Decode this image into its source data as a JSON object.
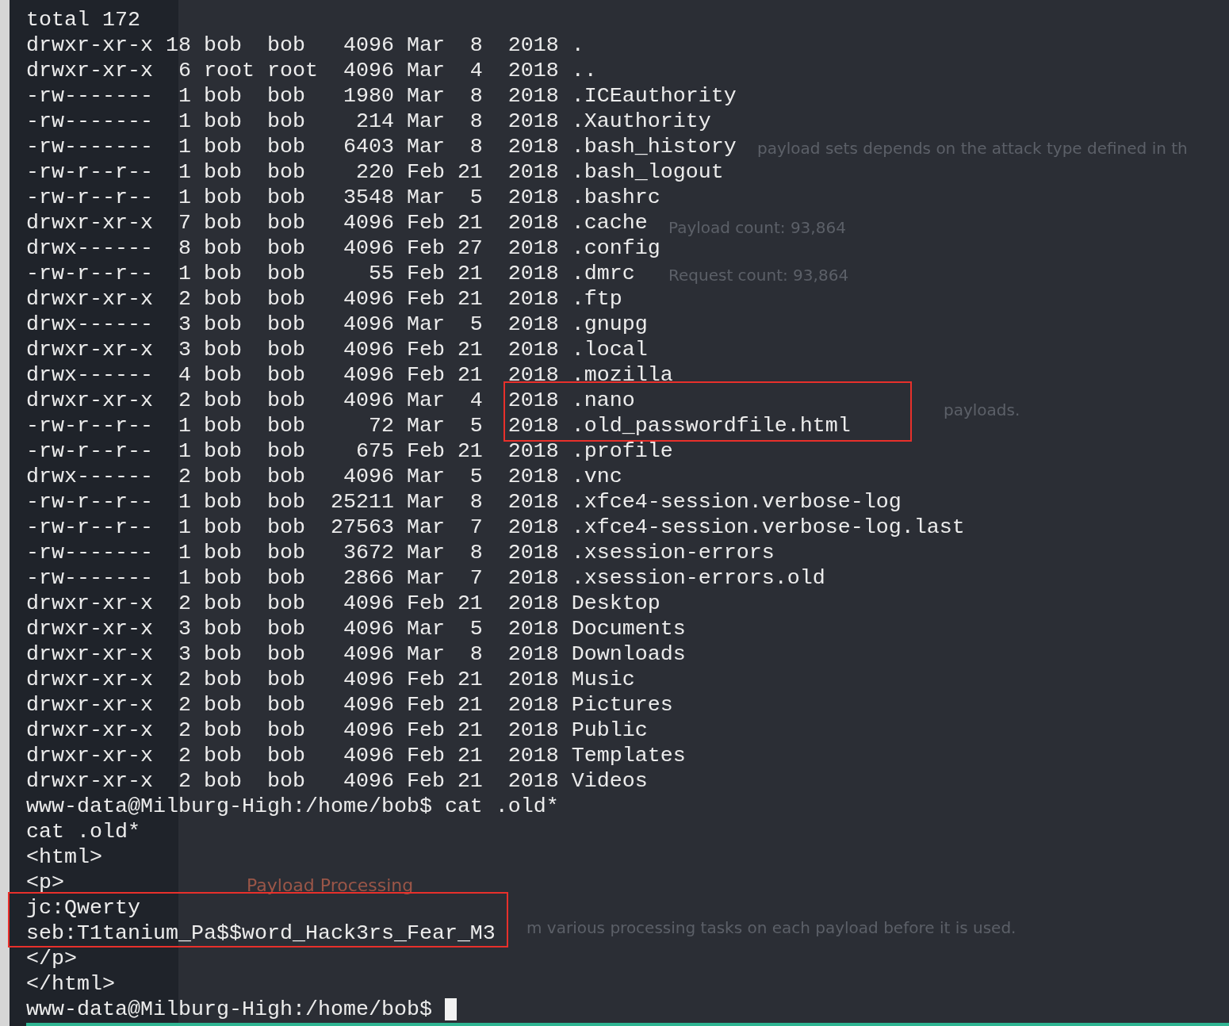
{
  "background_window": {
    "texts": [
      {
        "kind": "sentence",
        "text": "payload sets depends on the attack type defined in th"
      },
      {
        "kind": "stat",
        "text": "Payload count:  93,864"
      },
      {
        "kind": "stat",
        "text": "Request count:  93,864"
      },
      {
        "kind": "sentence",
        "text": "payloads."
      },
      {
        "kind": "heading",
        "text": "Payload Processing"
      },
      {
        "kind": "sentence",
        "text": "m various processing tasks on each payload before it is used."
      }
    ]
  },
  "terminal": {
    "blocks": [
      {
        "kind": "plain",
        "lines": [
          "total 172",
          "drwxr-xr-x 18 bob  bob   4096 Mar  8  2018 .",
          "drwxr-xr-x  6 root root  4096 Mar  4  2018 ..",
          "-rw-------  1 bob  bob   1980 Mar  8  2018 .ICEauthority",
          "-rw-------  1 bob  bob    214 Mar  8  2018 .Xauthority",
          "-rw-------  1 bob  bob   6403 Mar  8  2018 .bash_history",
          "-rw-r--r--  1 bob  bob    220 Feb 21  2018 .bash_logout",
          "-rw-r--r--  1 bob  bob   3548 Mar  5  2018 .bashrc",
          "drwxr-xr-x  7 bob  bob   4096 Feb 21  2018 .cache",
          "drwx------  8 bob  bob   4096 Feb 27  2018 .config",
          "-rw-r--r--  1 bob  bob     55 Feb 21  2018 .dmrc",
          "drwxr-xr-x  2 bob  bob   4096 Feb 21  2018 .ftp",
          "drwx------  3 bob  bob   4096 Mar  5  2018 .gnupg",
          "drwxr-xr-x  3 bob  bob   4096 Feb 21  2018 .local",
          "drwx------  4 bob  bob   4096 Feb 21  2018 .mozilla"
        ]
      },
      {
        "kind": "boxed",
        "lines": [
          {
            "before": "drwxr-xr-x  2 bob  bob   4096 Mar  4  ",
            "boxed": "2018 .nano"
          },
          {
            "before": "-rw-r--r--  1 bob  bob     72 Mar  5  ",
            "boxed": "2018 .old_passwordfile.html"
          }
        ]
      },
      {
        "kind": "plain",
        "lines": [
          "-rw-r--r--  1 bob  bob    675 Feb 21  2018 .profile",
          "drwx------  2 bob  bob   4096 Mar  5  2018 .vnc",
          "-rw-r--r--  1 bob  bob  25211 Mar  8  2018 .xfce4-session.verbose-log",
          "-rw-r--r--  1 bob  bob  27563 Mar  7  2018 .xfce4-session.verbose-log.last",
          "-rw-------  1 bob  bob   3672 Mar  8  2018 .xsession-errors",
          "-rw-------  1 bob  bob   2866 Mar  7  2018 .xsession-errors.old",
          "drwxr-xr-x  2 bob  bob   4096 Feb 21  2018 Desktop",
          "drwxr-xr-x  3 bob  bob   4096 Mar  5  2018 Documents",
          "drwxr-xr-x  3 bob  bob   4096 Mar  8  2018 Downloads",
          "drwxr-xr-x  2 bob  bob   4096 Feb 21  2018 Music",
          "drwxr-xr-x  2 bob  bob   4096 Feb 21  2018 Pictures",
          "drwxr-xr-x  2 bob  bob   4096 Feb 21  2018 Public",
          "drwxr-xr-x  2 bob  bob   4096 Feb 21  2018 Templates",
          "drwxr-xr-x  2 bob  bob   4096 Feb 21  2018 Videos",
          "www-data@Milburg-High:/home/bob$ cat .old*",
          "cat .old*",
          "<html>",
          "<p>"
        ]
      },
      {
        "kind": "boxed",
        "lines": [
          {
            "boxed": "jc:Qwerty"
          },
          {
            "boxed": "seb:T1tanium_Pa$$word_Hack3rs_Fear_M3"
          }
        ]
      },
      {
        "kind": "plain",
        "lines": [
          "</p>",
          "</html>"
        ]
      }
    ],
    "prompt": {
      "text": "www-data@Milburg-High:/home/bob$ ",
      "cursor": true
    }
  }
}
